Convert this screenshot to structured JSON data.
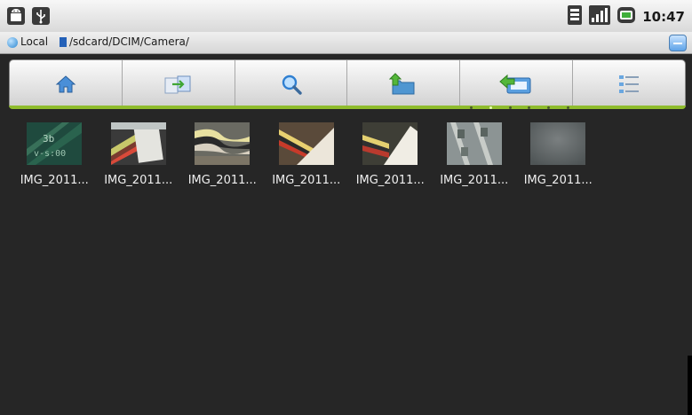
{
  "status_bar": {
    "time": "10:47",
    "notification_icons": [
      "android-icon",
      "usb-icon"
    ],
    "system_icons": [
      "wifi-icon",
      "signal-icon",
      "battery-icon"
    ]
  },
  "path_bar": {
    "storage_label": "Local",
    "path": "/sdcard/DCIM/Camera/"
  },
  "toolbar": {
    "buttons": [
      {
        "icon": "home-icon"
      },
      {
        "icon": "multi-select-icon"
      },
      {
        "icon": "search-icon"
      },
      {
        "icon": "up-folder-icon"
      },
      {
        "icon": "back-icon"
      },
      {
        "icon": "list-view-icon"
      }
    ],
    "page_count": 6,
    "active_page": 1
  },
  "files": [
    {
      "name": "IMG_2011..."
    },
    {
      "name": "IMG_2011..."
    },
    {
      "name": "IMG_2011..."
    },
    {
      "name": "IMG_2011..."
    },
    {
      "name": "IMG_2011..."
    },
    {
      "name": "IMG_2011..."
    },
    {
      "name": "IMG_2011..."
    }
  ],
  "colors": {
    "background": "#262626",
    "toolbar_accent": "#8fbc2d",
    "file_label": "#f0f0f0"
  }
}
